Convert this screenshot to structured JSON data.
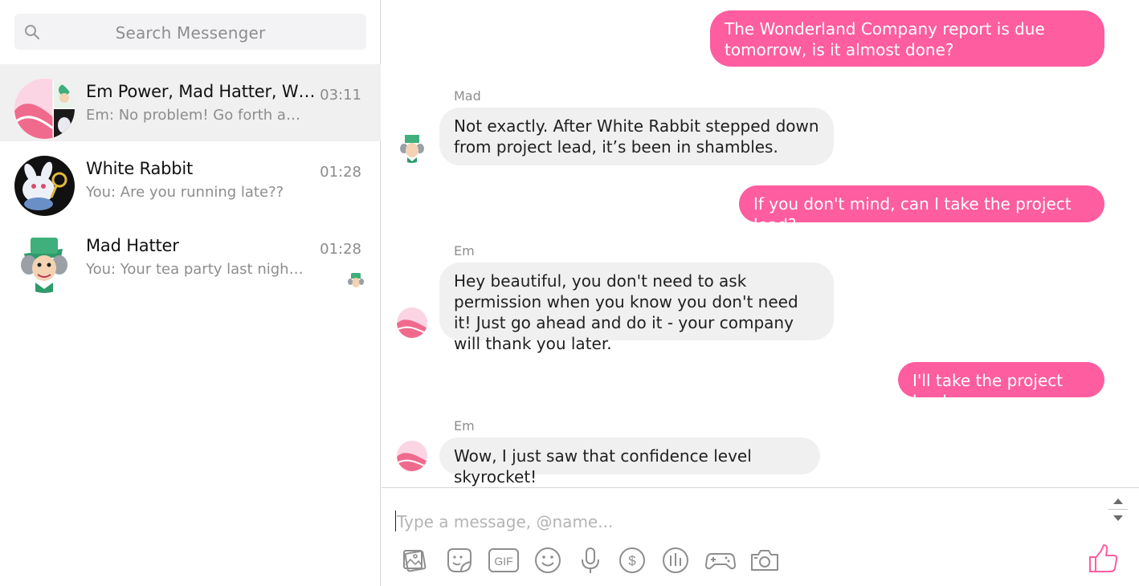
{
  "search": {
    "placeholder": "Search Messenger",
    "icon": "search-icon"
  },
  "conversations": [
    {
      "name": "Em Power, Mad Hatter, White Rabbit",
      "time": "03:11",
      "snippet": "Em: No problem! Go forth and conquer",
      "active": true
    },
    {
      "name": "White Rabbit",
      "time": "01:28",
      "snippet": "You: Are you running late??",
      "active": false
    },
    {
      "name": "Mad Hatter",
      "time": "01:28",
      "snippet": "You: Your tea party last night was great",
      "active": false
    }
  ],
  "messages": [
    {
      "type": "out",
      "text": "The Wonderland Company report is due tomorrow, is it almost done?"
    },
    {
      "type": "in",
      "sender": "Mad",
      "text": "Not exactly. After White Rabbit stepped down from project lead, it’s been in shambles."
    },
    {
      "type": "out",
      "text": "If you don't mind, can I take the project lead?"
    },
    {
      "type": "in",
      "sender": "Em",
      "text": "Hey beautiful, you don't need to ask permission when you know you don't need it! Just go ahead and do it - your company will thank you later."
    },
    {
      "type": "out",
      "text": "I'll take the project lead."
    },
    {
      "type": "in",
      "sender": "Em",
      "text": "Wow, I just saw that confidence level skyrocket!"
    }
  ],
  "composer": {
    "placeholder": "Type a message, @name..."
  },
  "toolbar": [
    "image-icon",
    "sticker-icon",
    "gif-icon",
    "emoji-icon",
    "microphone-icon",
    "payment-icon",
    "poll-icon",
    "game-icon",
    "camera-icon",
    "thumbs-up-icon"
  ],
  "colors": {
    "accent": "#fe5d9f",
    "incoming_bubble": "#f0f0f0",
    "active_row": "#f0f0f0"
  }
}
